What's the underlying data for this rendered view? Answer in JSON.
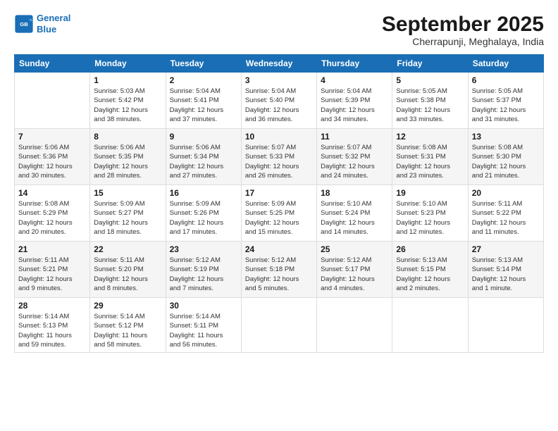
{
  "logo": {
    "line1": "General",
    "line2": "Blue"
  },
  "title": "September 2025",
  "location": "Cherrapunji, Meghalaya, India",
  "days_of_week": [
    "Sunday",
    "Monday",
    "Tuesday",
    "Wednesday",
    "Thursday",
    "Friday",
    "Saturday"
  ],
  "weeks": [
    [
      {
        "day": "",
        "info": ""
      },
      {
        "day": "1",
        "info": "Sunrise: 5:03 AM\nSunset: 5:42 PM\nDaylight: 12 hours\nand 38 minutes."
      },
      {
        "day": "2",
        "info": "Sunrise: 5:04 AM\nSunset: 5:41 PM\nDaylight: 12 hours\nand 37 minutes."
      },
      {
        "day": "3",
        "info": "Sunrise: 5:04 AM\nSunset: 5:40 PM\nDaylight: 12 hours\nand 36 minutes."
      },
      {
        "day": "4",
        "info": "Sunrise: 5:04 AM\nSunset: 5:39 PM\nDaylight: 12 hours\nand 34 minutes."
      },
      {
        "day": "5",
        "info": "Sunrise: 5:05 AM\nSunset: 5:38 PM\nDaylight: 12 hours\nand 33 minutes."
      },
      {
        "day": "6",
        "info": "Sunrise: 5:05 AM\nSunset: 5:37 PM\nDaylight: 12 hours\nand 31 minutes."
      }
    ],
    [
      {
        "day": "7",
        "info": "Sunrise: 5:06 AM\nSunset: 5:36 PM\nDaylight: 12 hours\nand 30 minutes."
      },
      {
        "day": "8",
        "info": "Sunrise: 5:06 AM\nSunset: 5:35 PM\nDaylight: 12 hours\nand 28 minutes."
      },
      {
        "day": "9",
        "info": "Sunrise: 5:06 AM\nSunset: 5:34 PM\nDaylight: 12 hours\nand 27 minutes."
      },
      {
        "day": "10",
        "info": "Sunrise: 5:07 AM\nSunset: 5:33 PM\nDaylight: 12 hours\nand 26 minutes."
      },
      {
        "day": "11",
        "info": "Sunrise: 5:07 AM\nSunset: 5:32 PM\nDaylight: 12 hours\nand 24 minutes."
      },
      {
        "day": "12",
        "info": "Sunrise: 5:08 AM\nSunset: 5:31 PM\nDaylight: 12 hours\nand 23 minutes."
      },
      {
        "day": "13",
        "info": "Sunrise: 5:08 AM\nSunset: 5:30 PM\nDaylight: 12 hours\nand 21 minutes."
      }
    ],
    [
      {
        "day": "14",
        "info": "Sunrise: 5:08 AM\nSunset: 5:29 PM\nDaylight: 12 hours\nand 20 minutes."
      },
      {
        "day": "15",
        "info": "Sunrise: 5:09 AM\nSunset: 5:27 PM\nDaylight: 12 hours\nand 18 minutes."
      },
      {
        "day": "16",
        "info": "Sunrise: 5:09 AM\nSunset: 5:26 PM\nDaylight: 12 hours\nand 17 minutes."
      },
      {
        "day": "17",
        "info": "Sunrise: 5:09 AM\nSunset: 5:25 PM\nDaylight: 12 hours\nand 15 minutes."
      },
      {
        "day": "18",
        "info": "Sunrise: 5:10 AM\nSunset: 5:24 PM\nDaylight: 12 hours\nand 14 minutes."
      },
      {
        "day": "19",
        "info": "Sunrise: 5:10 AM\nSunset: 5:23 PM\nDaylight: 12 hours\nand 12 minutes."
      },
      {
        "day": "20",
        "info": "Sunrise: 5:11 AM\nSunset: 5:22 PM\nDaylight: 12 hours\nand 11 minutes."
      }
    ],
    [
      {
        "day": "21",
        "info": "Sunrise: 5:11 AM\nSunset: 5:21 PM\nDaylight: 12 hours\nand 9 minutes."
      },
      {
        "day": "22",
        "info": "Sunrise: 5:11 AM\nSunset: 5:20 PM\nDaylight: 12 hours\nand 8 minutes."
      },
      {
        "day": "23",
        "info": "Sunrise: 5:12 AM\nSunset: 5:19 PM\nDaylight: 12 hours\nand 7 minutes."
      },
      {
        "day": "24",
        "info": "Sunrise: 5:12 AM\nSunset: 5:18 PM\nDaylight: 12 hours\nand 5 minutes."
      },
      {
        "day": "25",
        "info": "Sunrise: 5:12 AM\nSunset: 5:17 PM\nDaylight: 12 hours\nand 4 minutes."
      },
      {
        "day": "26",
        "info": "Sunrise: 5:13 AM\nSunset: 5:15 PM\nDaylight: 12 hours\nand 2 minutes."
      },
      {
        "day": "27",
        "info": "Sunrise: 5:13 AM\nSunset: 5:14 PM\nDaylight: 12 hours\nand 1 minute."
      }
    ],
    [
      {
        "day": "28",
        "info": "Sunrise: 5:14 AM\nSunset: 5:13 PM\nDaylight: 11 hours\nand 59 minutes."
      },
      {
        "day": "29",
        "info": "Sunrise: 5:14 AM\nSunset: 5:12 PM\nDaylight: 11 hours\nand 58 minutes."
      },
      {
        "day": "30",
        "info": "Sunrise: 5:14 AM\nSunset: 5:11 PM\nDaylight: 11 hours\nand 56 minutes."
      },
      {
        "day": "",
        "info": ""
      },
      {
        "day": "",
        "info": ""
      },
      {
        "day": "",
        "info": ""
      },
      {
        "day": "",
        "info": ""
      }
    ]
  ]
}
